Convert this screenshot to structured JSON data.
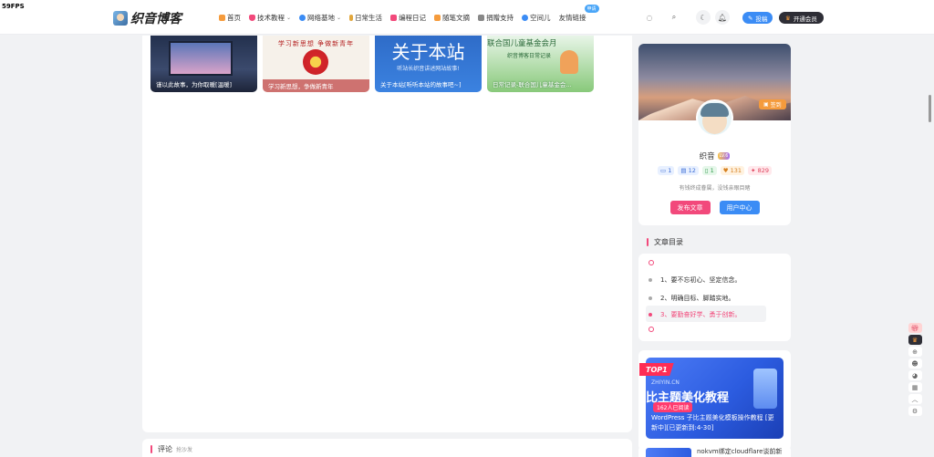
{
  "fps": "59FPS",
  "header": {
    "logo_text": "织音博客",
    "nav": [
      {
        "label": "首页",
        "icon": "home-icon",
        "color": "#f59b3c",
        "caret": false
      },
      {
        "label": "技术教程",
        "icon": "shield-icon",
        "color": "#f2497b",
        "caret": true
      },
      {
        "label": "网络基地",
        "icon": "network-icon",
        "color": "#3b8cf5",
        "caret": true
      },
      {
        "label": "日常生活",
        "icon": "bottle-icon",
        "color": "#e2a73d",
        "caret": false
      },
      {
        "label": "编程日记",
        "icon": "code-icon",
        "color": "#f2497b",
        "caret": false
      },
      {
        "label": "随笔文摘",
        "icon": "note-icon",
        "color": "#f59b3c",
        "caret": false
      },
      {
        "label": "捐赠支持",
        "icon": "heart-hand-icon",
        "color": "#888888",
        "caret": false
      },
      {
        "label": "空间儿",
        "icon": "planet-icon",
        "color": "#3b8cf5",
        "caret": false
      },
      {
        "label": "友情链接",
        "icon": "",
        "color": "",
        "caret": false,
        "badge": "申请"
      }
    ],
    "vip_label": "投稿",
    "member_label": "开通会员"
  },
  "thumbs": [
    {
      "caption": "谨以此故事，为你取暖[温暖]"
    },
    {
      "caption": "学习新思想，争做新青年",
      "head": "学习新思想  争做新青年"
    },
    {
      "caption": "关于本站[听听本站的故事吧~]",
      "big": "关于本站",
      "sub": "听站长织音讲述网站故事!"
    },
    {
      "caption": "日常记录-联合国儿童基金会...",
      "head": "联合国儿童基金会月",
      "sub": "织音博客日常记录"
    }
  ],
  "comment": {
    "title": "评论",
    "sub": "抢沙发"
  },
  "profile": {
    "signin_label": "签到",
    "name": "织音",
    "level": "LV.6",
    "stats": [
      {
        "icon": "comment-icon",
        "value": "1",
        "bg": "#e8f0ff",
        "fg": "#3b6cd6"
      },
      {
        "icon": "doc-icon",
        "value": "12",
        "bg": "#e8f0ff",
        "fg": "#3b6cd6"
      },
      {
        "icon": "bookmark-icon",
        "value": "1",
        "bg": "#e6f7ea",
        "fg": "#2f9a4b"
      },
      {
        "icon": "like-icon",
        "value": "131",
        "bg": "#fff2e0",
        "fg": "#d6801e"
      },
      {
        "icon": "fire-icon",
        "value": "829",
        "bg": "#ffe9ec",
        "fg": "#e0435e"
      }
    ],
    "motto": "有钱终成眷属，没钱亲眼目睹",
    "publish_label": "发布文章",
    "center_label": "用户中心"
  },
  "toc": {
    "title": "文章目录",
    "items": [
      "1、要不忘初心、坚定信念。",
      "2、明确目标、脚踏实地。",
      "3、要勤奋好学、勇于创新。"
    ]
  },
  "promo": {
    "tag": "TOP1",
    "site": "ZHIYIN.CN",
    "big": "比主题美化教程",
    "badge": "162人已阅读",
    "title": "WordPress 子比主题美化模板操作教程 [更新中][已更新到:4-30]",
    "next_title": "nokvm绑定cloudflare谈前新"
  },
  "colors": {
    "accent": "#f2497b",
    "blue": "#3b8cf5",
    "orange": "#f59b3c"
  }
}
